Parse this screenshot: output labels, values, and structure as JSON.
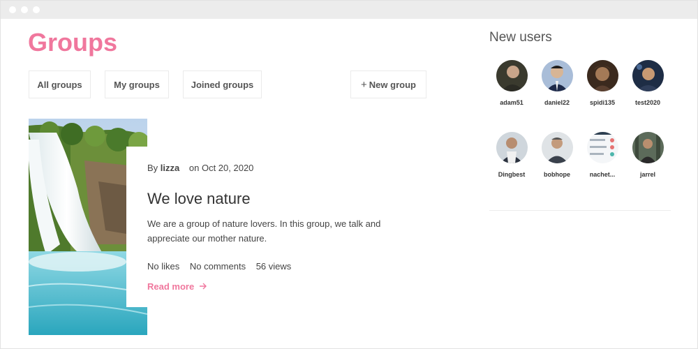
{
  "page": {
    "title": "Groups"
  },
  "filters": {
    "all_groups": "All groups",
    "my_groups": "My groups",
    "joined_groups": "Joined groups",
    "new_group": "New group",
    "new_group_icon": "plus-icon"
  },
  "post": {
    "by_label": "By",
    "author": "lizza",
    "date": "on Oct 20, 2020",
    "title": "We love nature",
    "description": "We are a group of nature lovers. In this group, we talk and appreciate our mother nature.",
    "likes": "No likes",
    "comments": "No comments",
    "views": "56 views",
    "read_more": "Read more",
    "read_more_icon": "arrow-right-icon",
    "cover_image": "waterfall-photo"
  },
  "new_users": {
    "title": "New users",
    "users": [
      {
        "name": "adam51"
      },
      {
        "name": "daniel22"
      },
      {
        "name": "spidi135"
      },
      {
        "name": "test2020"
      },
      {
        "name": "Dingbest"
      },
      {
        "name": "bobhope"
      },
      {
        "name": "nachet..."
      },
      {
        "name": "jarrel"
      }
    ]
  },
  "colors": {
    "accent": "#f0779d",
    "titlebar": "#ececec"
  }
}
